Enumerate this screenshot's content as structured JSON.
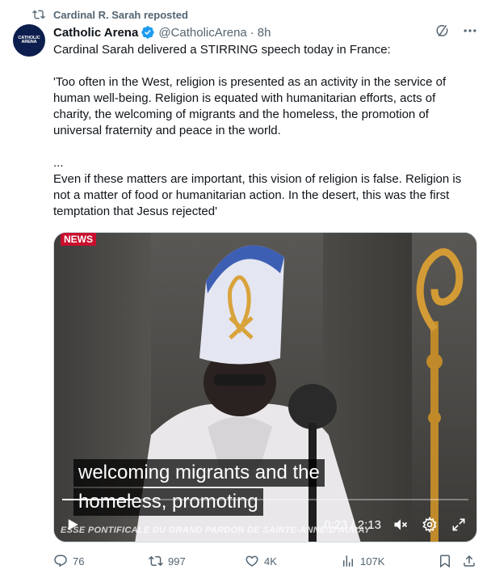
{
  "repost": {
    "label": "Cardinal R. Sarah reposted",
    "icon": "repost-icon"
  },
  "author": {
    "avatar_text": "CATHOLIC ARENA",
    "name": "Catholic Arena",
    "handle": "@CatholicArena",
    "separator": "·",
    "time": "8h",
    "verified": true
  },
  "tweet": {
    "line1": "Cardinal Sarah delivered a STIRRING speech today in France:",
    "para1": "'Too often in the West, religion is presented as an activity in the service of human well-being. Religion is equated with humanitarian efforts, acts of charity, the welcoming of migrants and the homeless, the promotion of universal fraternity and peace in the world.",
    "ellipsis": "...",
    "para2": "Even if these matters are important, this vision of religion is false. Religion is not a matter of food or humanitarian action. In the desert, this was the first temptation that Jesus rejected'"
  },
  "video": {
    "news_tag": "NEWS",
    "subtitle_line1": "welcoming migrants and the",
    "subtitle_line2": "homeless, promoting",
    "lower_third": "ESSE PONTIFICALE DU GRAND PARDON DE SAINTE-ANNE-D'AURAY",
    "time_readout": "0:23 / 2:13",
    "progress_fraction": 0.173
  },
  "actions": {
    "replies": "76",
    "reposts": "997",
    "likes": "4K",
    "views": "107K"
  },
  "colors": {
    "text": "#0f1419",
    "secondary": "#536471",
    "verified": "#1d9bf0",
    "news_red": "#c8102e"
  }
}
